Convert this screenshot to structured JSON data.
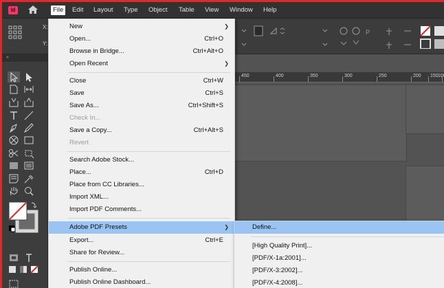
{
  "app": {
    "logo_text": "Id",
    "accent": "#ff3366",
    "frame_color": "#e8262a"
  },
  "menubar": {
    "items": [
      "File",
      "Edit",
      "Layout",
      "Type",
      "Object",
      "Table",
      "View",
      "Window",
      "Help"
    ],
    "active": "File"
  },
  "controlbar": {
    "x_label": "X:",
    "y_label": "Y:"
  },
  "ruler": {
    "labels": [
      "450",
      "400",
      "350",
      "300",
      "250",
      "200",
      "150",
      "100"
    ]
  },
  "file_menu": {
    "items": [
      {
        "label": "New",
        "shortcut": "",
        "submenu": true
      },
      {
        "label": "Open...",
        "shortcut": "Ctrl+O"
      },
      {
        "label": "Browse in Bridge...",
        "shortcut": "Ctrl+Alt+O"
      },
      {
        "label": "Open Recent",
        "shortcut": "",
        "submenu": true
      },
      {
        "label": "Close",
        "shortcut": "Ctrl+W"
      },
      {
        "label": "Save",
        "shortcut": "Ctrl+S"
      },
      {
        "label": "Save As...",
        "shortcut": "Ctrl+Shift+S"
      },
      {
        "label": "Check In...",
        "shortcut": "",
        "disabled": true
      },
      {
        "label": "Save a Copy...",
        "shortcut": "Ctrl+Alt+S"
      },
      {
        "label": "Revert",
        "shortcut": "",
        "disabled": true
      },
      {
        "label": "Search Adobe Stock...",
        "shortcut": ""
      },
      {
        "label": "Place...",
        "shortcut": "Ctrl+D"
      },
      {
        "label": "Place from CC Libraries...",
        "shortcut": ""
      },
      {
        "label": "Import XML...",
        "shortcut": ""
      },
      {
        "label": "Import PDF Comments...",
        "shortcut": ""
      },
      {
        "label": "Adobe PDF Presets",
        "shortcut": "",
        "submenu": true,
        "highlighted": true
      },
      {
        "label": "Export...",
        "shortcut": "Ctrl+E"
      },
      {
        "label": "Share for Review...",
        "shortcut": ""
      },
      {
        "label": "Publish Online...",
        "shortcut": ""
      },
      {
        "label": "Publish Online Dashboard...",
        "shortcut": ""
      }
    ]
  },
  "pdf_presets_submenu": {
    "items": [
      {
        "label": "Define...",
        "highlighted": true
      },
      {
        "label": "[High Quality Print]..."
      },
      {
        "label": "[PDF/X-1a:2001]..."
      },
      {
        "label": "[PDF/X-3:2002]..."
      },
      {
        "label": "[PDF/X-4:2008]..."
      }
    ]
  }
}
